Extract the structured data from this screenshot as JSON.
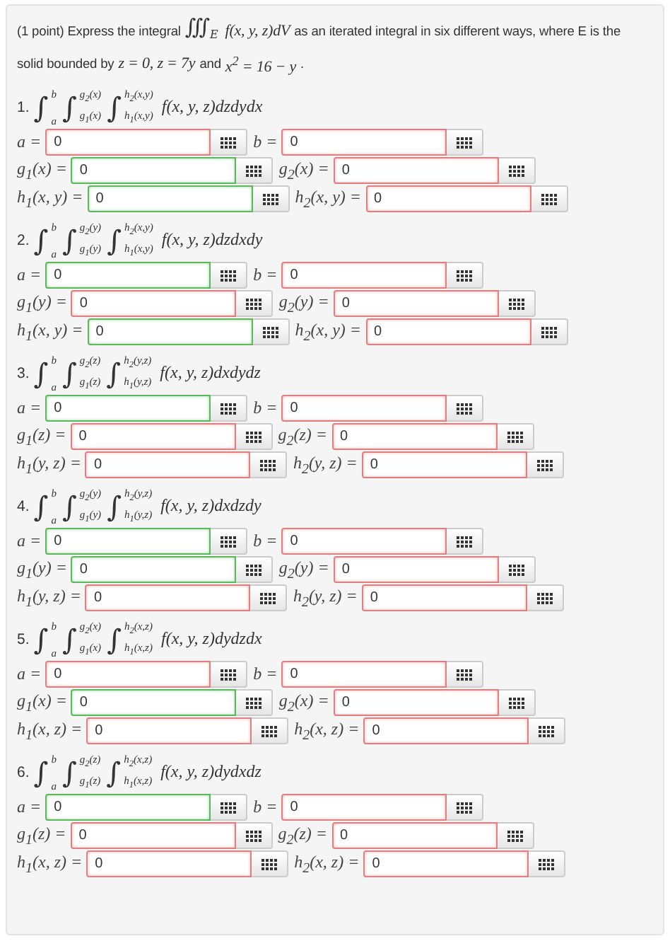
{
  "intro": {
    "before": "(1 point) Express the integral",
    "integral_sign": "∭",
    "region": "E",
    "integrand": "f(x, y, z)dV",
    "after": "as an iterated integral in six different ways, where E is the",
    "line2": "solid bounded by",
    "bounds": "z = 0, z = 7y",
    "joiner": "and",
    "surface": "x$^{2}$ = 16 − y",
    "end": "."
  },
  "parts": [
    {
      "number": "1.",
      "integrals": [
        {
          "sign": "∫",
          "upper": "b",
          "lower": "a"
        },
        {
          "sign": "∫",
          "upper": "g$_{2}$(x)",
          "lower": "g$_{1}$(x)"
        },
        {
          "sign": "∫",
          "upper": "h$_{2}$(x,y)",
          "lower": "h$_{1}$(x,y)"
        }
      ],
      "integrand": "f(x, y, z)dzdydx",
      "fields": [
        {
          "label": "a =",
          "value": "0",
          "correct": false
        },
        {
          "label": "b =",
          "value": "0",
          "correct": false
        },
        {
          "label": "g$_{1}$(x) =",
          "value": "0",
          "correct": true
        },
        {
          "label": "g$_{2}$(x) =",
          "value": "0",
          "correct": false
        },
        {
          "label": "h$_{1}$(x, y) =",
          "value": "0",
          "correct": true
        },
        {
          "label": "h$_{2}$(x, y) =",
          "value": "0",
          "correct": false
        }
      ]
    },
    {
      "number": "2.",
      "integrals": [
        {
          "sign": "∫",
          "upper": "b",
          "lower": "a"
        },
        {
          "sign": "∫",
          "upper": "g$_{2}$(y)",
          "lower": "g$_{1}$(y)"
        },
        {
          "sign": "∫",
          "upper": "h$_{2}$(x,y)",
          "lower": "h$_{1}$(x,y)"
        }
      ],
      "integrand": "f(x, y, z)dzdxdy",
      "fields": [
        {
          "label": "a =",
          "value": "0",
          "correct": true
        },
        {
          "label": "b =",
          "value": "0",
          "correct": false
        },
        {
          "label": "g$_{1}$(y) =",
          "value": "0",
          "correct": false
        },
        {
          "label": "g$_{2}$(y) =",
          "value": "0",
          "correct": false
        },
        {
          "label": "h$_{1}$(x, y) =",
          "value": "0",
          "correct": true
        },
        {
          "label": "h$_{2}$(x, y) =",
          "value": "0",
          "correct": false
        }
      ]
    },
    {
      "number": "3.",
      "integrals": [
        {
          "sign": "∫",
          "upper": "b",
          "lower": "a"
        },
        {
          "sign": "∫",
          "upper": "g$_{2}$(z)",
          "lower": "g$_{1}$(z)"
        },
        {
          "sign": "∫",
          "upper": "h$_{2}$(y,z)",
          "lower": "h$_{1}$(y,z)"
        }
      ],
      "integrand": "f(x, y, z)dxdydz",
      "fields": [
        {
          "label": "a =",
          "value": "0",
          "correct": true
        },
        {
          "label": "b =",
          "value": "0",
          "correct": false
        },
        {
          "label": "g$_{1}$(z) =",
          "value": "0",
          "correct": false
        },
        {
          "label": "g$_{2}$(z) =",
          "value": "0",
          "correct": false
        },
        {
          "label": "h$_{1}$(y, z) =",
          "value": "0",
          "correct": false
        },
        {
          "label": "h$_{2}$(y, z) =",
          "value": "0",
          "correct": false
        }
      ]
    },
    {
      "number": "4.",
      "integrals": [
        {
          "sign": "∫",
          "upper": "b",
          "lower": "a"
        },
        {
          "sign": "∫",
          "upper": "g$_{2}$(y)",
          "lower": "g$_{1}$(y)"
        },
        {
          "sign": "∫",
          "upper": "h$_{2}$(y,z)",
          "lower": "h$_{1}$(y,z)"
        }
      ],
      "integrand": "f(x, y, z)dxdzdy",
      "fields": [
        {
          "label": "a =",
          "value": "0",
          "correct": true
        },
        {
          "label": "b =",
          "value": "0",
          "correct": false
        },
        {
          "label": "g$_{1}$(y) =",
          "value": "0",
          "correct": true
        },
        {
          "label": "g$_{2}$(y) =",
          "value": "0",
          "correct": false
        },
        {
          "label": "h$_{1}$(y, z) =",
          "value": "0",
          "correct": false
        },
        {
          "label": "h$_{2}$(y, z) =",
          "value": "0",
          "correct": false
        }
      ]
    },
    {
      "number": "5.",
      "integrals": [
        {
          "sign": "∫",
          "upper": "b",
          "lower": "a"
        },
        {
          "sign": "∫",
          "upper": "g$_{2}$(x)",
          "lower": "g$_{1}$(x)"
        },
        {
          "sign": "∫",
          "upper": "h$_{2}$(x,z)",
          "lower": "h$_{1}$(x,z)"
        }
      ],
      "integrand": "f(x, y, z)dydzdx",
      "fields": [
        {
          "label": "a =",
          "value": "0",
          "correct": false
        },
        {
          "label": "b =",
          "value": "0",
          "correct": false
        },
        {
          "label": "g$_{1}$(x) =",
          "value": "0",
          "correct": true
        },
        {
          "label": "g$_{2}$(x) =",
          "value": "0",
          "correct": false
        },
        {
          "label": "h$_{1}$(x, z) =",
          "value": "0",
          "correct": false
        },
        {
          "label": "h$_{2}$(x, z) =",
          "value": "0",
          "correct": false
        }
      ]
    },
    {
      "number": "6.",
      "integrals": [
        {
          "sign": "∫",
          "upper": "b",
          "lower": "a"
        },
        {
          "sign": "∫",
          "upper": "g$_{2}$(z)",
          "lower": "g$_{1}$(z)"
        },
        {
          "sign": "∫",
          "upper": "h$_{2}$(x,z)",
          "lower": "h$_{1}$(x,z)"
        }
      ],
      "integrand": "f(x, y, z)dydxdz",
      "fields": [
        {
          "label": "a =",
          "value": "0",
          "correct": true
        },
        {
          "label": "b =",
          "value": "0",
          "correct": false
        },
        {
          "label": "g$_{1}$(z) =",
          "value": "0",
          "correct": false
        },
        {
          "label": "g$_{2}$(z) =",
          "value": "0",
          "correct": false
        },
        {
          "label": "h$_{1}$(x, z) =",
          "value": "0",
          "correct": false
        },
        {
          "label": "h$_{2}$(x, z) =",
          "value": "0",
          "correct": false
        }
      ]
    }
  ]
}
